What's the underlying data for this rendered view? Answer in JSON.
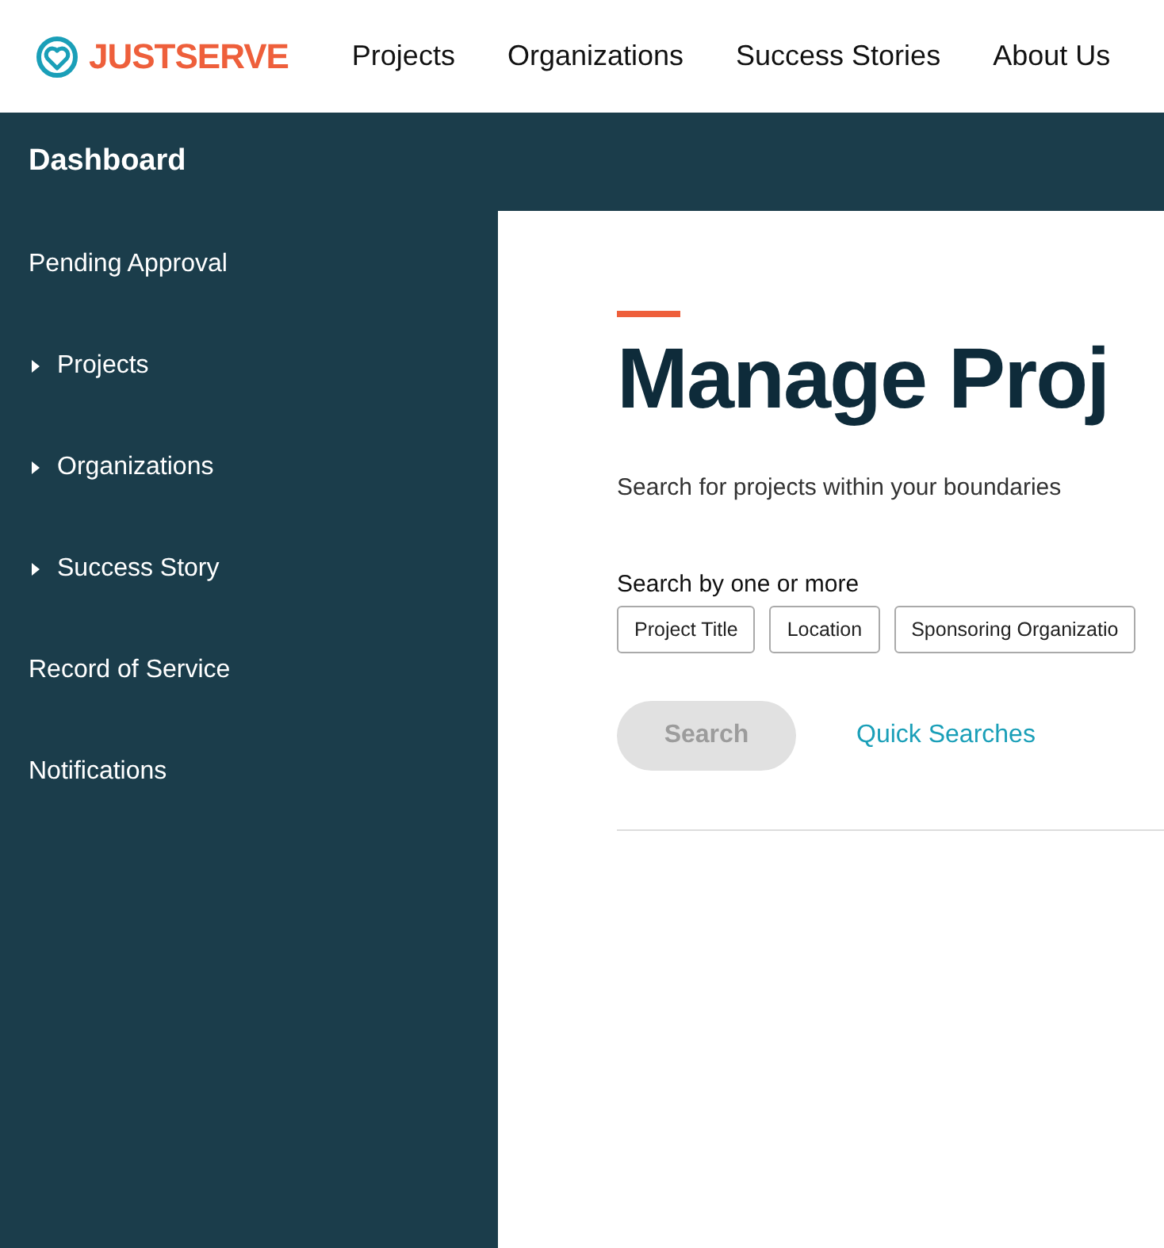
{
  "header": {
    "logo": "JUSTSERVE",
    "nav": [
      "Projects",
      "Organizations",
      "Success Stories",
      "About Us"
    ]
  },
  "sidebar": {
    "title": "Dashboard",
    "items": [
      {
        "label": "Pending Approval",
        "kind": "link"
      },
      {
        "label": "Projects",
        "kind": "expandable",
        "expanded": false
      },
      {
        "label": "Organizations",
        "kind": "expandable",
        "expanded": false
      },
      {
        "label": "Success Story",
        "kind": "expandable",
        "expanded": false
      },
      {
        "label": "Record of Service",
        "kind": "link"
      },
      {
        "label": "Notifications",
        "kind": "link"
      }
    ]
  },
  "main": {
    "title": "Manage Proj",
    "subtitle": "Search for projects within your boundaries",
    "filter_label": "Search by one or more",
    "filters": [
      {
        "label": "Project Title",
        "selected": false
      },
      {
        "label": "Location",
        "selected": false
      },
      {
        "label": "Sponsoring Organizatio",
        "selected": false
      }
    ],
    "search_button": {
      "label": "Search",
      "disabled": true
    },
    "quick_searches": "Quick Searches"
  }
}
